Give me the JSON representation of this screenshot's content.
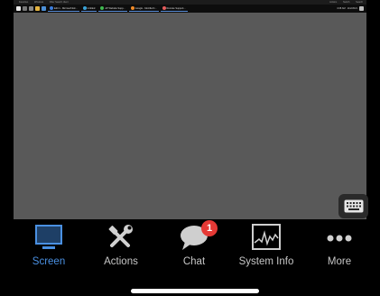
{
  "remote": {
    "menubar": {
      "items": [
        "Favorites",
        "Windows",
        "Filter Search client"
      ],
      "right_items": [
        "Actions",
        "Switch",
        "Search"
      ]
    },
    "taskbar": {
      "tabs": [
        {
          "label": "Edit 1 - Microsoft Ed...",
          "color": "#3b7ddd"
        },
        {
          "label": "Untitled",
          "color": "#3aa3d9"
        },
        {
          "label": "AP Website Supp...",
          "color": "#3fb950"
        },
        {
          "label": "Google - Mozilla Fi...",
          "color": "#f28c28"
        },
        {
          "label": "Remote Support...",
          "color": "#e55c5c"
        }
      ],
      "tray_time": "4:08 AM",
      "tray_date": "11/2/2021"
    }
  },
  "toolbar": {
    "items": [
      {
        "id": "screen",
        "label": "Screen",
        "icon": "monitor-icon",
        "active": true
      },
      {
        "id": "actions",
        "label": "Actions",
        "icon": "tools-icon",
        "active": false
      },
      {
        "id": "chat",
        "label": "Chat",
        "icon": "chat-bubble-icon",
        "active": false,
        "badge": "1"
      },
      {
        "id": "sysinfo",
        "label": "System Info",
        "icon": "system-graph-icon",
        "active": false
      },
      {
        "id": "more",
        "label": "More",
        "icon": "ellipsis-icon",
        "active": false
      }
    ]
  },
  "colors": {
    "active": "#4a90e2",
    "inactive": "#c6c6c6",
    "badge": "#e53935",
    "remote_bg": "#595959"
  }
}
